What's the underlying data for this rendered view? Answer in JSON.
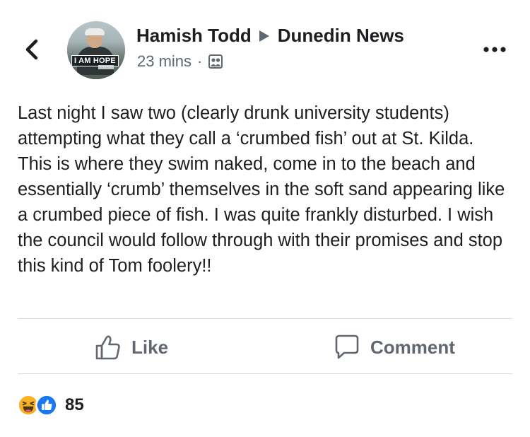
{
  "post": {
    "author": "Hamish Todd",
    "group": "Dunedin News",
    "timestamp": "23 mins",
    "separator": "·",
    "avatar_badge": "I AM HOPE",
    "privacy_icon": "group-audience-icon",
    "body": "Last night I saw two (clearly drunk university students) attempting what they call a ‘crumbed fish’ out at St. Kilda. This is where they swim naked, come in to the beach and essentially ‘crumb’ themselves in the soft sand appearing like a crumbed piece of fish. I was quite frankly disturbed. I wish the council would follow through with their promises and stop this kind of Tom foolery!!"
  },
  "actions": {
    "like_label": "Like",
    "comment_label": "Comment"
  },
  "reactions": {
    "types": [
      "haha",
      "like"
    ],
    "count": "85"
  },
  "colors": {
    "text_primary": "#1c1e21",
    "text_secondary": "#606770",
    "divider": "#d8dadf",
    "like_blue": "#1877f2",
    "haha_yellow": "#f7b125"
  }
}
